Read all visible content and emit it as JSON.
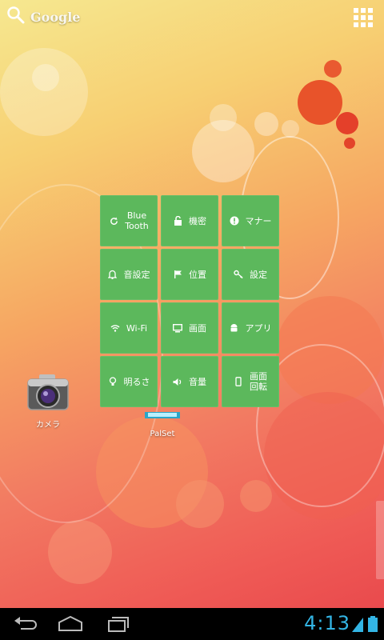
{
  "search": {
    "label": "Google"
  },
  "widget": {
    "tiles": [
      {
        "label": "Blue\nTooth",
        "icon": "refresh-icon"
      },
      {
        "label": "機密",
        "icon": "unlock-icon"
      },
      {
        "label": "マナー",
        "icon": "alert-icon"
      },
      {
        "label": "音設定",
        "icon": "bell-icon"
      },
      {
        "label": "位置",
        "icon": "flag-icon"
      },
      {
        "label": "設定",
        "icon": "key-icon"
      },
      {
        "label": "Wi-Fi",
        "icon": "wifi-icon"
      },
      {
        "label": "画面",
        "icon": "monitor-icon"
      },
      {
        "label": "アプリ",
        "icon": "android-icon"
      },
      {
        "label": "明るさ",
        "icon": "bulb-icon"
      },
      {
        "label": "音量",
        "icon": "speaker-icon"
      },
      {
        "label": "画面\n回転",
        "icon": "phone-icon"
      }
    ],
    "tile_color": "#5cb85c"
  },
  "shortcuts": {
    "camera": {
      "label": "カメラ"
    },
    "palset": {
      "label": "PalSet"
    }
  },
  "status": {
    "time": "4:13",
    "accent": "#33b5e5"
  }
}
